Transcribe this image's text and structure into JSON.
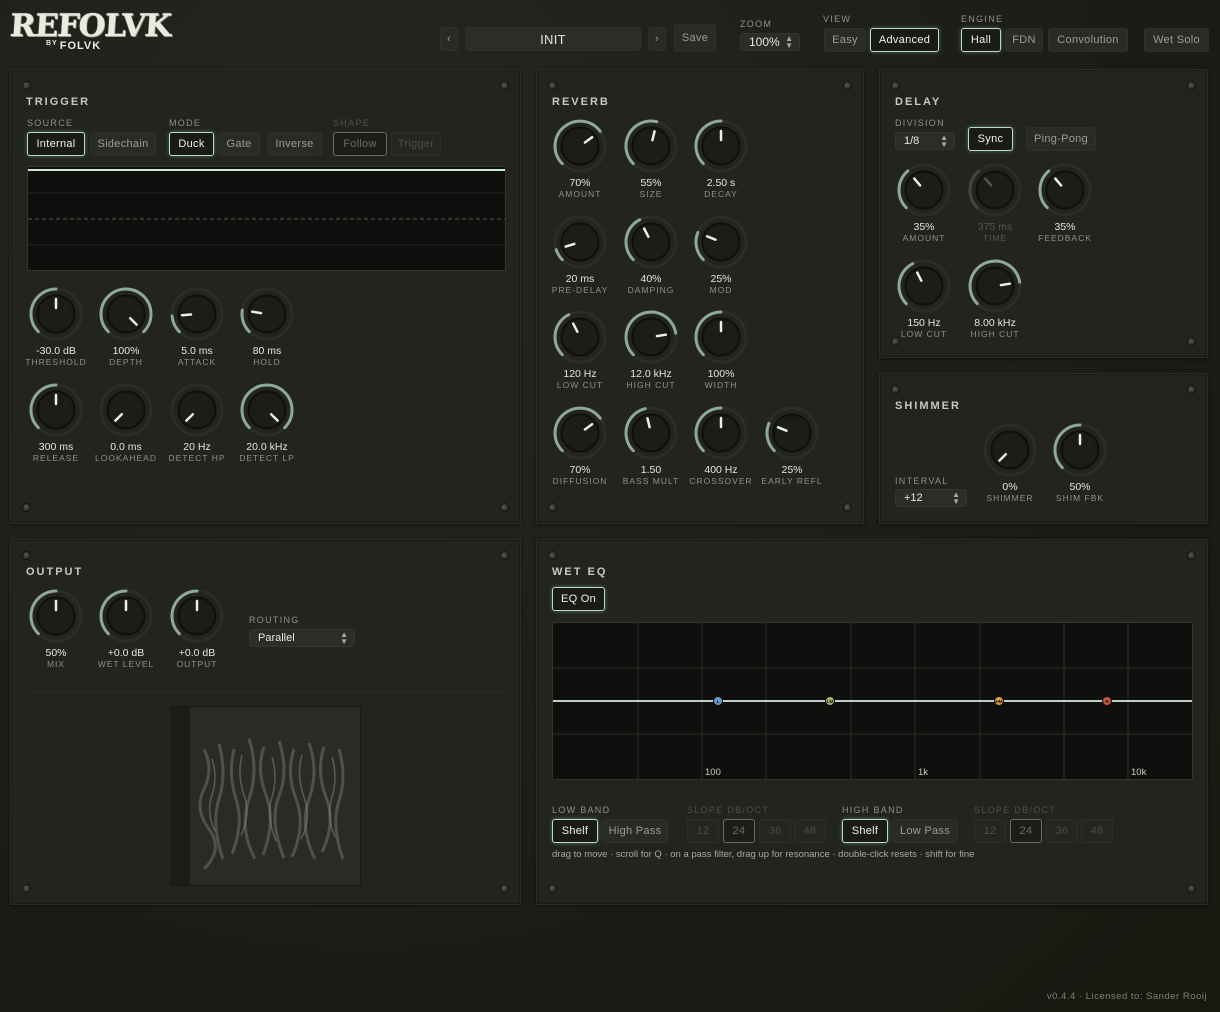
{
  "brand": {
    "name": "REFOLVK",
    "by": "BY",
    "maker": "FOLVK"
  },
  "header": {
    "prev": "‹",
    "preset": "INIT",
    "next": "›",
    "save": "Save",
    "zoom_label": "ZOOM",
    "zoom_value": "100%",
    "view_label": "VIEW",
    "view_options": [
      "Easy",
      "Advanced"
    ],
    "view_selected": "Advanced",
    "engine_label": "ENGINE",
    "engine_options": [
      "Hall",
      "FDN",
      "Convolution"
    ],
    "engine_selected": "Hall",
    "wet_solo": "Wet Solo"
  },
  "trigger": {
    "title": "TRIGGER",
    "source_label": "SOURCE",
    "source": [
      "Internal",
      "Sidechain"
    ],
    "source_selected": "Internal",
    "mode_label": "MODE",
    "mode": [
      "Duck",
      "Gate",
      "Inverse"
    ],
    "mode_selected": "Duck",
    "shape_label": "SHAPE",
    "shape": [
      "Follow",
      "Trigger"
    ],
    "knobs": [
      {
        "value": "-30.0 dB",
        "name": "THRESHOLD",
        "level": 0.5
      },
      {
        "value": "100%",
        "name": "DEPTH",
        "level": 1.0
      },
      {
        "value": "5.0 ms",
        "name": "ATTACK",
        "level": 0.15
      },
      {
        "value": "80 ms",
        "name": "HOLD",
        "level": 0.2
      },
      {
        "value": "300 ms",
        "name": "RELEASE",
        "level": 0.5
      },
      {
        "value": "0.0 ms",
        "name": "LOOKAHEAD",
        "level": 0.0
      },
      {
        "value": "20 Hz",
        "name": "DETECT HP",
        "level": 0.0
      },
      {
        "value": "20.0 kHz",
        "name": "DETECT LP",
        "level": 1.0
      }
    ]
  },
  "reverb": {
    "title": "REVERB",
    "knobs": [
      {
        "value": "70%",
        "name": "AMOUNT",
        "level": 0.7
      },
      {
        "value": "55%",
        "name": "SIZE",
        "level": 0.55
      },
      {
        "value": "2.50 s",
        "name": "DECAY",
        "level": 0.5
      },
      {
        "value": "20 ms",
        "name": "PRE-DELAY",
        "level": 0.1
      },
      {
        "value": "40%",
        "name": "DAMPING",
        "level": 0.4
      },
      {
        "value": "25%",
        "name": "MOD",
        "level": 0.25
      },
      {
        "value": "120 Hz",
        "name": "LOW CUT",
        "level": 0.4
      },
      {
        "value": "12.0 kHz",
        "name": "HIGH CUT",
        "level": 0.8
      },
      {
        "value": "100%",
        "name": "WIDTH",
        "level": 0.5
      },
      {
        "value": "70%",
        "name": "DIFFUSION",
        "level": 0.7
      },
      {
        "value": "1.50",
        "name": "BASS MULT",
        "level": 0.45
      },
      {
        "value": "400 Hz",
        "name": "CROSSOVER",
        "level": 0.5
      },
      {
        "value": "25%",
        "name": "EARLY REFL",
        "level": 0.25
      }
    ]
  },
  "delay": {
    "title": "DELAY",
    "division_label": "DIVISION",
    "division": "1/8",
    "sync": "Sync",
    "pingpong": "Ping-Pong",
    "knobs": [
      {
        "value": "35%",
        "name": "AMOUNT",
        "level": 0.35
      },
      {
        "value": "375 ms",
        "name": "TIME",
        "level": 0.35,
        "disabled": true
      },
      {
        "value": "35%",
        "name": "FEEDBACK",
        "level": 0.35
      },
      {
        "value": "150 Hz",
        "name": "LOW CUT",
        "level": 0.4
      },
      {
        "value": "8.00 kHz",
        "name": "HIGH CUT",
        "level": 0.8
      }
    ]
  },
  "shimmer": {
    "title": "SHIMMER",
    "interval_label": "INTERVAL",
    "interval": "+12",
    "knobs": [
      {
        "value": "0%",
        "name": "SHIMMER",
        "level": 0.0
      },
      {
        "value": "50%",
        "name": "SHIM FBK",
        "level": 0.5
      }
    ]
  },
  "output": {
    "title": "OUTPUT",
    "routing_label": "ROUTING",
    "routing": "Parallel",
    "knobs": [
      {
        "value": "50%",
        "name": "MIX",
        "level": 0.5
      },
      {
        "value": "+0.0 dB",
        "name": "WET LEVEL",
        "level": 0.5
      },
      {
        "value": "+0.0 dB",
        "name": "OUTPUT",
        "level": 0.5
      }
    ]
  },
  "weteq": {
    "title": "WET EQ",
    "eq_on": "EQ On",
    "freq_labels": [
      "100",
      "1k",
      "10k"
    ],
    "band_markers": [
      "L",
      "LM",
      "HM",
      "H"
    ],
    "band_colors": [
      "#6a9ac8",
      "#a8b070",
      "#d8a040",
      "#c05a40"
    ],
    "low_band_label": "LOW BAND",
    "low_band": [
      "Shelf",
      "High Pass"
    ],
    "slope_label": "SLOPE DB/OCT",
    "slopes": [
      "12",
      "24",
      "36",
      "48"
    ],
    "high_band_label": "HIGH BAND",
    "high_band": [
      "Shelf",
      "Low Pass"
    ],
    "hint": "drag to move · scroll for Q · on a pass filter, drag up for resonance · double-click resets · shift for fine"
  },
  "footer": "v0.4.4 · Licensed to: Sander Rooij",
  "colors": {
    "accent": "#b8dcc8",
    "knob_arc": "#8fa89c"
  }
}
